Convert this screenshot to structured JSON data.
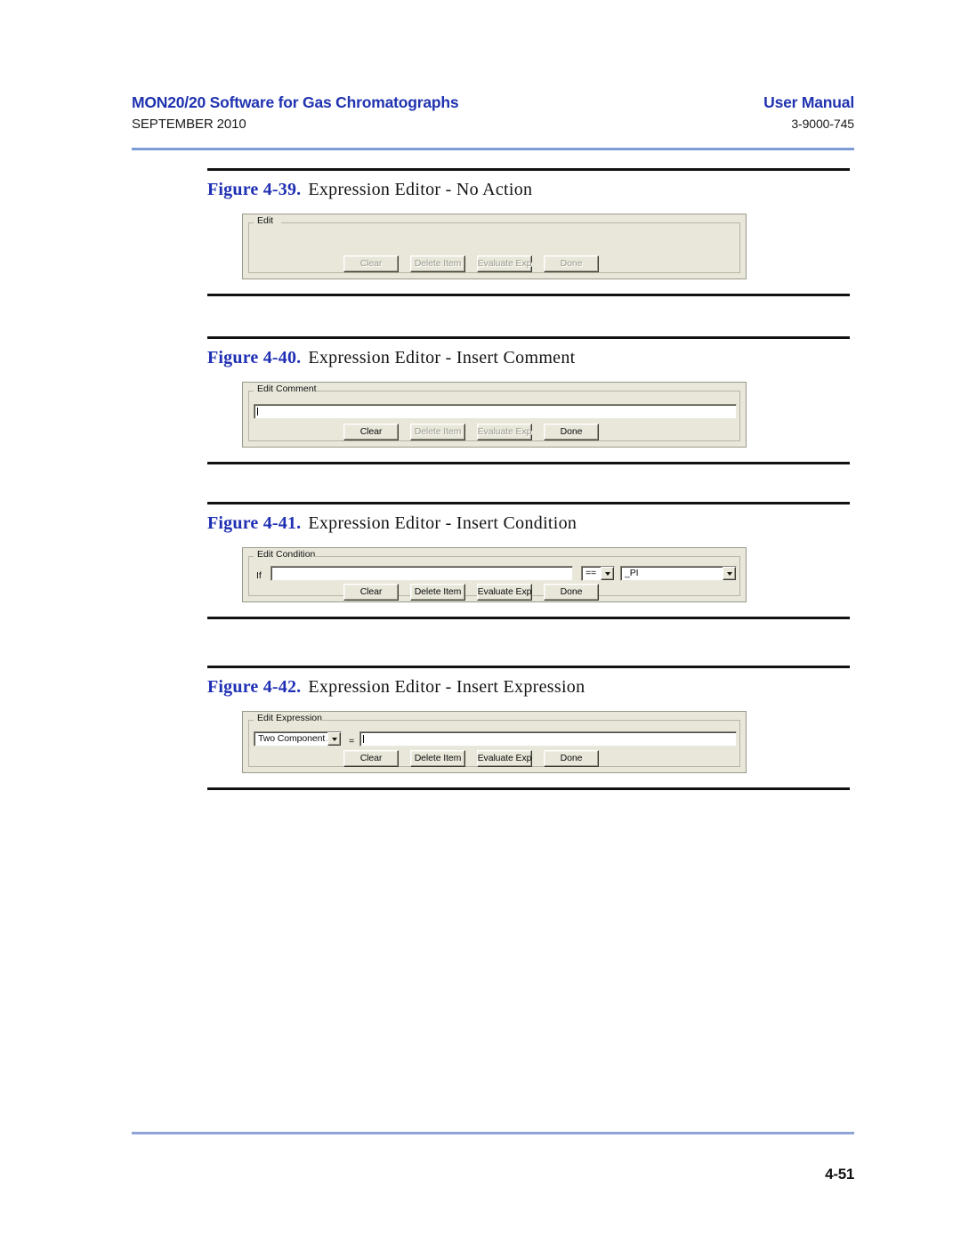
{
  "header": {
    "title": "MON20/20 Software for Gas Chromatographs",
    "date": "SEPTEMBER 2010",
    "manual_label": "User Manual",
    "doc_number": "3-9000-745"
  },
  "footer": {
    "page_number": "4-51"
  },
  "figures": [
    {
      "number": "Figure 4-39.",
      "caption": "Expression Editor - No Action",
      "groupbox_label": "Edit",
      "buttons": [
        {
          "label": "Clear",
          "enabled": false
        },
        {
          "label": "Delete Item",
          "enabled": false
        },
        {
          "label": "Evaluate Exp",
          "enabled": false
        },
        {
          "label": "Done",
          "enabled": false
        }
      ]
    },
    {
      "number": "Figure 4-40.",
      "caption": "Expression Editor - Insert Comment",
      "groupbox_label": "Edit Comment",
      "comment_input_value": "",
      "buttons": [
        {
          "label": "Clear",
          "enabled": true
        },
        {
          "label": "Delete Item",
          "enabled": false
        },
        {
          "label": "Evaluate Exp",
          "enabled": false
        },
        {
          "label": "Done",
          "enabled": true
        }
      ]
    },
    {
      "number": "Figure 4-41.",
      "caption": "Expression Editor - Insert Condition",
      "groupbox_label": "Edit Condition",
      "if_label": "If",
      "condition_input_value": "",
      "operator_value": "==",
      "operand_value": "_PI",
      "buttons": [
        {
          "label": "Clear",
          "enabled": true
        },
        {
          "label": "Delete Item",
          "enabled": true
        },
        {
          "label": "Evaluate Exp",
          "enabled": true
        },
        {
          "label": "Done",
          "enabled": true
        }
      ]
    },
    {
      "number": "Figure 4-42.",
      "caption": "Expression Editor - Insert Expression",
      "groupbox_label": "Edit Expression",
      "variable_value": "Two Component A",
      "equals_label": "=",
      "expression_input_value": "",
      "buttons": [
        {
          "label": "Clear",
          "enabled": true
        },
        {
          "label": "Delete Item",
          "enabled": true
        },
        {
          "label": "Evaluate Exp",
          "enabled": true
        },
        {
          "label": "Done",
          "enabled": true
        }
      ]
    }
  ]
}
